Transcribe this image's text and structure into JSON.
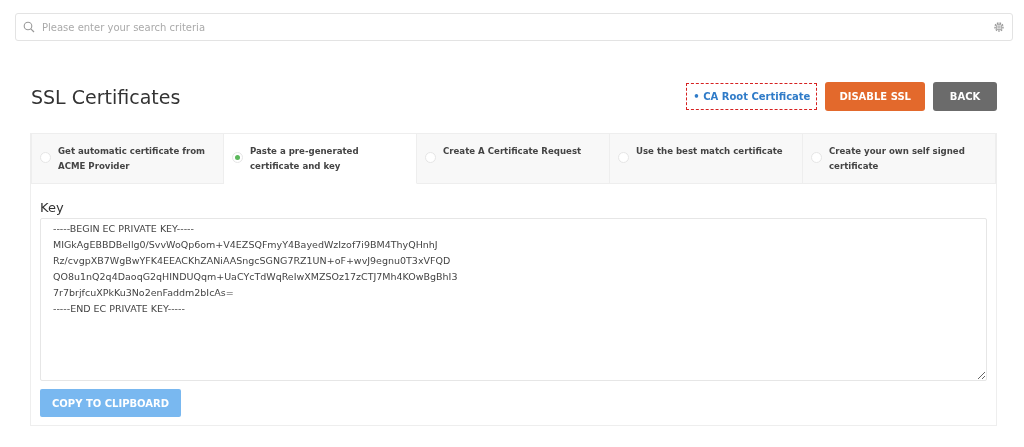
{
  "search": {
    "placeholder": "Please enter your search criteria"
  },
  "page": {
    "title": "SSL Certificates"
  },
  "actions": [
    {
      "kind": "link",
      "label": "• CA Root Certificate",
      "highlighted": true
    },
    {
      "kind": "warning",
      "label": "DISABLE SSL"
    },
    {
      "kind": "neutral",
      "label": "BACK"
    }
  ],
  "tabs": [
    {
      "label": "Get automatic certificate from ACME Provider",
      "selected": false
    },
    {
      "label": "Paste a pre-generated certificate and key",
      "selected": true
    },
    {
      "label": "Create A Certificate Request",
      "selected": false
    },
    {
      "label": "Use the best match certificate",
      "selected": false
    },
    {
      "label": "Create your own self signed certificate",
      "selected": false
    }
  ],
  "key": {
    "label": "Key",
    "value": "-----BEGIN EC PRIVATE KEY-----\nMIGkAgEBBDBeIlg0/SvvWoQp6om+V4EZSQFmyY4BayedWzIzof7i9BM4ThyQHnhJ\nRz/cvgpXB7WgBwYFK4EEACKhZANiAASngcSGNG7RZ1UN+oF+wvJ9egnu0T3xVFQD\nQO8u1nQ2q4DaoqG2qHINDUQqm+UaCYcTdWqReIwXMZSOz17zCTJ7Mh4KOwBgBhI3\n7r7brjfcuXPkKu3No2enFaddm2bIcAs=\n-----END EC PRIVATE KEY-----"
  },
  "copy_button": {
    "label": "COPY TO CLIPBOARD"
  }
}
